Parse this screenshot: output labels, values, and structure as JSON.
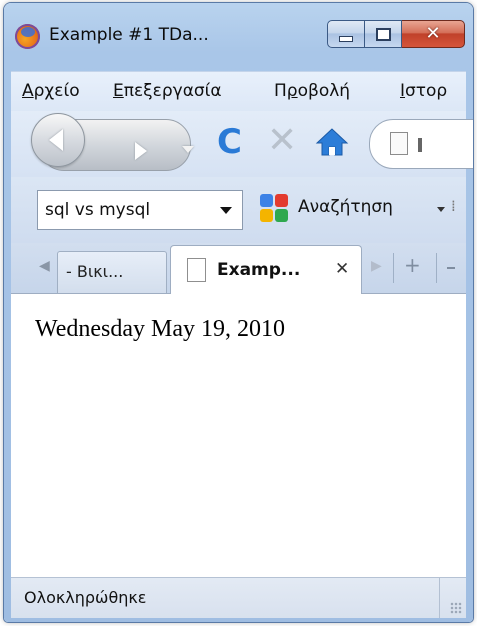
{
  "window": {
    "title": "Example #1 TDa..."
  },
  "menubar": {
    "items": [
      {
        "first": "Α",
        "rest": "ρχείο"
      },
      {
        "first": "Ε",
        "rest": "πεξεργασία"
      },
      {
        "first": "Π",
        "pre": "",
        "rest": "ροβολή",
        "underline_index": 1
      },
      {
        "first": "Ι",
        "rest": "στορ"
      }
    ],
    "labels": [
      "Αρχείο",
      "Επεξεργασία",
      "Προβολή",
      "Ιστορ"
    ]
  },
  "navbar": {
    "icons": [
      "back-icon",
      "forward-icon",
      "reload-icon",
      "stop-icon",
      "home-icon",
      "page-icon"
    ],
    "reload_glyph": "C",
    "stop_glyph": "✕"
  },
  "searchbar": {
    "query": "sql vs mysql",
    "engine_label": "Αναζήτηση"
  },
  "tabs": [
    {
      "label": "- Βικι..."
    },
    {
      "label": "Examp...",
      "close": "✕",
      "active": true
    }
  ],
  "content": {
    "text": "Wednesday May 19, 2010"
  },
  "status": {
    "text": "Ολοκληρώθηκε"
  },
  "colors": {
    "accent_blue": "#2a7ad6",
    "close_red": "#c0412a",
    "frame_blue": "#a9c6e8"
  }
}
